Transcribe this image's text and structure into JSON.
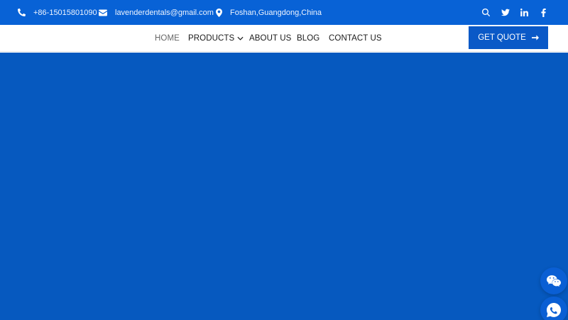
{
  "topbar": {
    "phone": "+86-15015801090",
    "email": "lavenderdentals@gmail.com",
    "location": "Foshan,Guangdong,China",
    "icons": [
      "phone-icon",
      "mail-icon",
      "map-pin-icon",
      "search-icon",
      "twitter-icon",
      "linkedin-icon",
      "facebook-icon"
    ],
    "background": "#0862d6"
  },
  "nav": {
    "items": [
      {
        "label": "HOME",
        "active": true
      },
      {
        "label": "PRODUCTS",
        "has_dropdown": true
      },
      {
        "label": "ABOUT US"
      },
      {
        "label": "BLOG"
      },
      {
        "label": "CONTACT US"
      }
    ]
  },
  "cta": {
    "label": "GET QUOTE",
    "icon": "arrow-right-icon",
    "background": "#0a59c7"
  },
  "hero": {
    "background": "#0659bf"
  },
  "floating": {
    "icons": [
      "wechat-icon",
      "whatsapp-icon"
    ]
  }
}
